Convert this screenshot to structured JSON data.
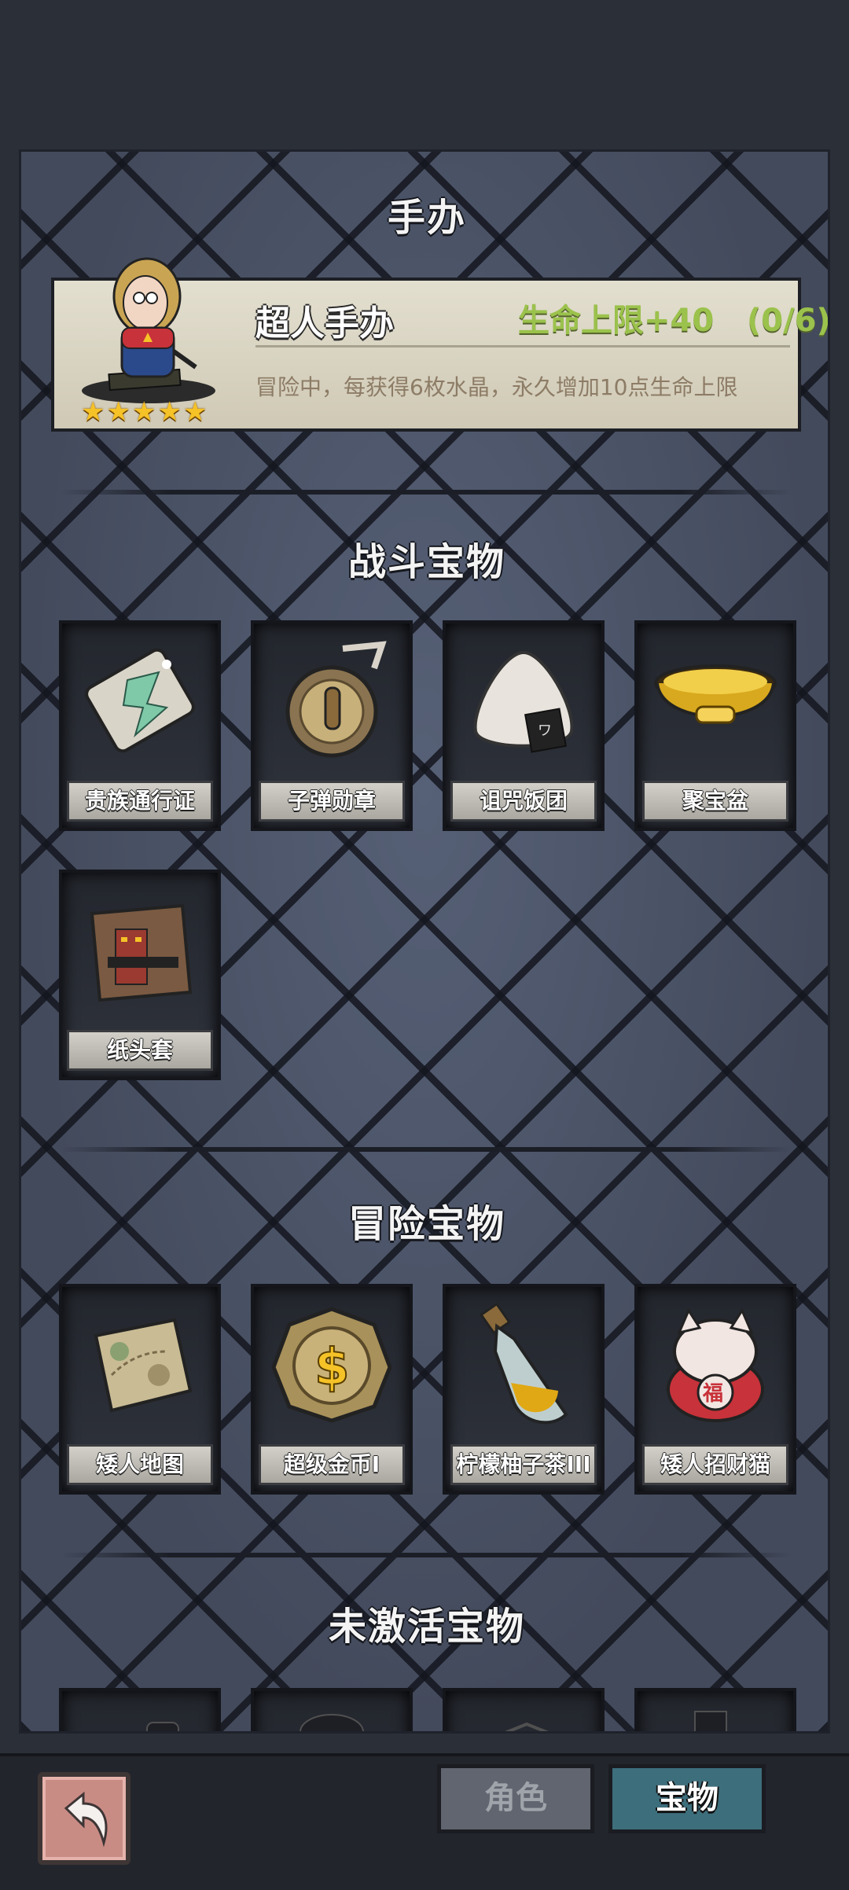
{
  "figure_section": {
    "title": "手办",
    "name": "超人手办",
    "bonus": "生命上限+40",
    "progress": "(0/6)",
    "description": "冒险中，每获得6枚水晶，永久增加10点生命上限",
    "stars": 5
  },
  "combat_section": {
    "title": "战斗宝物",
    "items": [
      {
        "label": "贵族通行证",
        "icon": "card-icon"
      },
      {
        "label": "子弹勋章",
        "icon": "medal-icon"
      },
      {
        "label": "诅咒饭团",
        "icon": "rice-ball-icon"
      },
      {
        "label": "聚宝盆",
        "icon": "treasure-bowl-icon"
      },
      {
        "label": "纸头套",
        "icon": "paper-bag-icon"
      }
    ]
  },
  "adventure_section": {
    "title": "冒险宝物",
    "items": [
      {
        "label": "矮人地图",
        "icon": "map-icon"
      },
      {
        "label": "超级金币I",
        "icon": "gold-coin-icon"
      },
      {
        "label": "柠檬柚子茶III",
        "icon": "potion-icon"
      },
      {
        "label": "矮人招财猫",
        "icon": "lucky-cat-icon"
      }
    ]
  },
  "inactive_section": {
    "title": "未激活宝物"
  },
  "tabs": {
    "role": "角色",
    "treasure": "宝物"
  },
  "colors": {
    "bonus_green": "#9bc24c",
    "star_gold": "#f5c227",
    "active_tab": "#3d6e7c"
  }
}
